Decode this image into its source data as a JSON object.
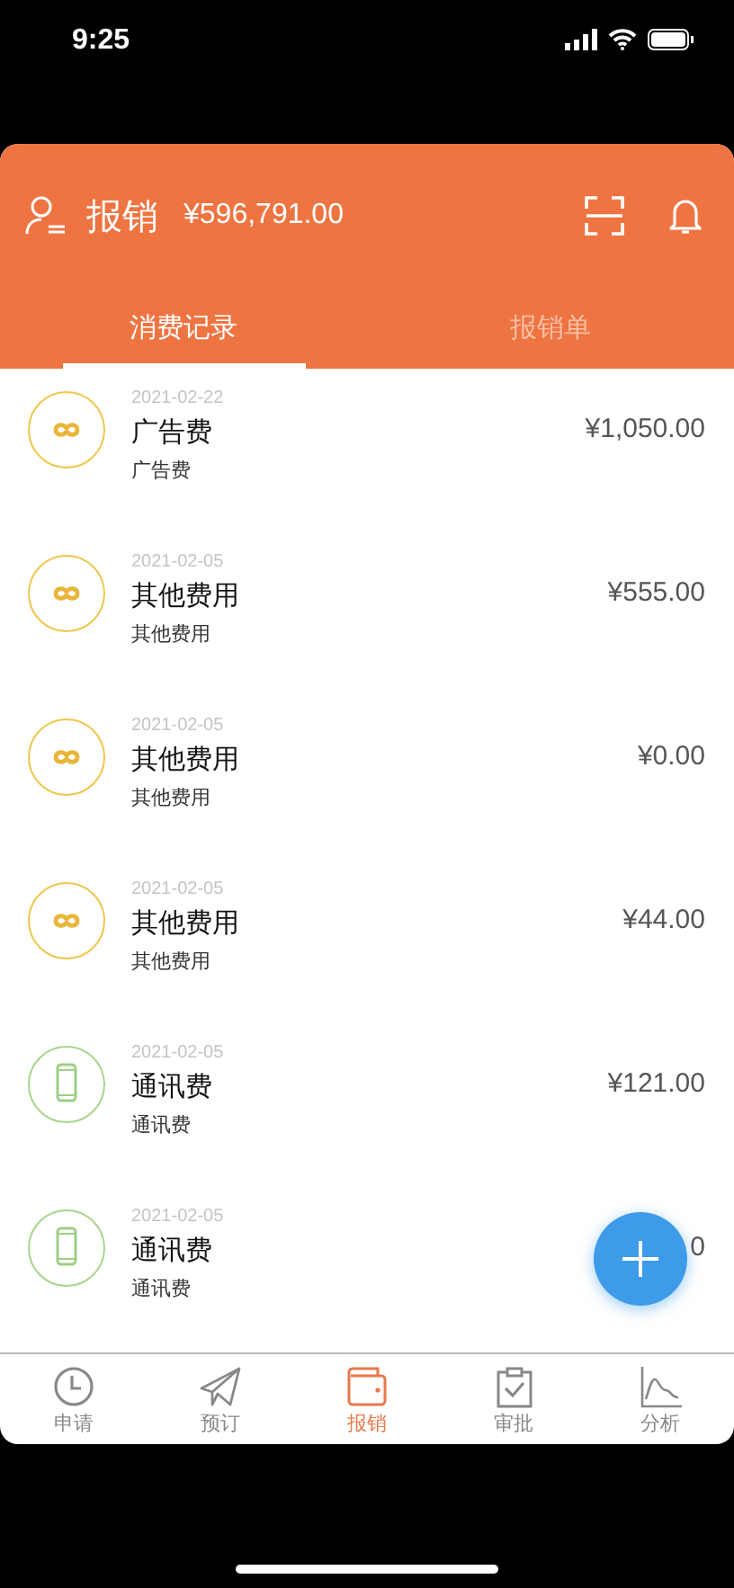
{
  "status_bar": {
    "time": "9:25"
  },
  "header": {
    "title": "报销",
    "amount": "¥596,791.00"
  },
  "tabs": [
    {
      "label": "消费记录",
      "selected": true
    },
    {
      "label": "报销单",
      "selected": false
    }
  ],
  "records": [
    {
      "kind": "infinity",
      "date": "2021-02-22",
      "title": "广告费",
      "subtitle": "广告费",
      "amount": "¥1,050.00"
    },
    {
      "kind": "infinity",
      "date": "2021-02-05",
      "title": "其他费用",
      "subtitle": "其他费用",
      "amount": "¥555.00"
    },
    {
      "kind": "infinity",
      "date": "2021-02-05",
      "title": "其他费用",
      "subtitle": "其他费用",
      "amount": "¥0.00"
    },
    {
      "kind": "infinity",
      "date": "2021-02-05",
      "title": "其他费用",
      "subtitle": "其他费用",
      "amount": "¥44.00"
    },
    {
      "kind": "phone",
      "date": "2021-02-05",
      "title": "通讯费",
      "subtitle": "通讯费",
      "amount": "¥121.00"
    },
    {
      "kind": "phone",
      "date": "2021-02-05",
      "title": "通讯费",
      "subtitle": "通讯费",
      "amount": "0"
    }
  ],
  "nav": [
    {
      "kind": "clock",
      "label": "申请",
      "selected": false
    },
    {
      "kind": "plane",
      "label": "预订",
      "selected": false
    },
    {
      "kind": "wallet",
      "label": "报销",
      "selected": true
    },
    {
      "kind": "clipboard",
      "label": "审批",
      "selected": false
    },
    {
      "kind": "chart",
      "label": "分析",
      "selected": false
    }
  ]
}
